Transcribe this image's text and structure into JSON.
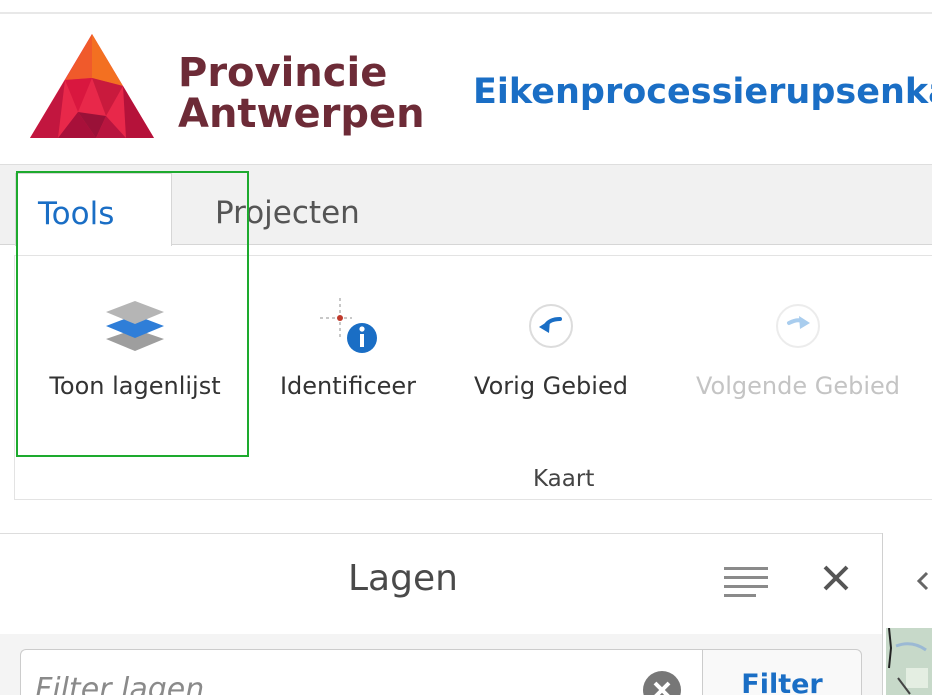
{
  "header": {
    "brand_line1": "Provincie",
    "brand_line2": "Antwerpen",
    "app_title": "Eikenprocessierupsenka",
    "logo_icon": "province-triangle-logo-icon",
    "brand_color": "#6d2b37",
    "title_color": "#1a6ec5"
  },
  "tabs": [
    {
      "label": "Tools",
      "active": true
    },
    {
      "label": "Projecten",
      "active": false
    }
  ],
  "ribbon": {
    "group_label": "Kaart",
    "tools": [
      {
        "label": "Toon lagenlijst",
        "icon": "layers-stack-icon",
        "enabled": true
      },
      {
        "label": "Identificeer",
        "icon": "identify-info-icon",
        "enabled": true
      },
      {
        "label": "Vorig Gebied",
        "icon": "arrow-left-circle-icon",
        "enabled": true
      },
      {
        "label": "Volgende Gebied",
        "icon": "arrow-right-circle-icon",
        "enabled": false
      }
    ],
    "highlight_color": "#1daa2e"
  },
  "layers_panel": {
    "title": "Lagen",
    "menu_icon": "hamburger-menu-icon",
    "close_icon": "close-icon",
    "filter_placeholder": "Filter lagen",
    "filter_value": "",
    "filter_button": "Filter",
    "clear_icon": "clear-circle-icon"
  }
}
